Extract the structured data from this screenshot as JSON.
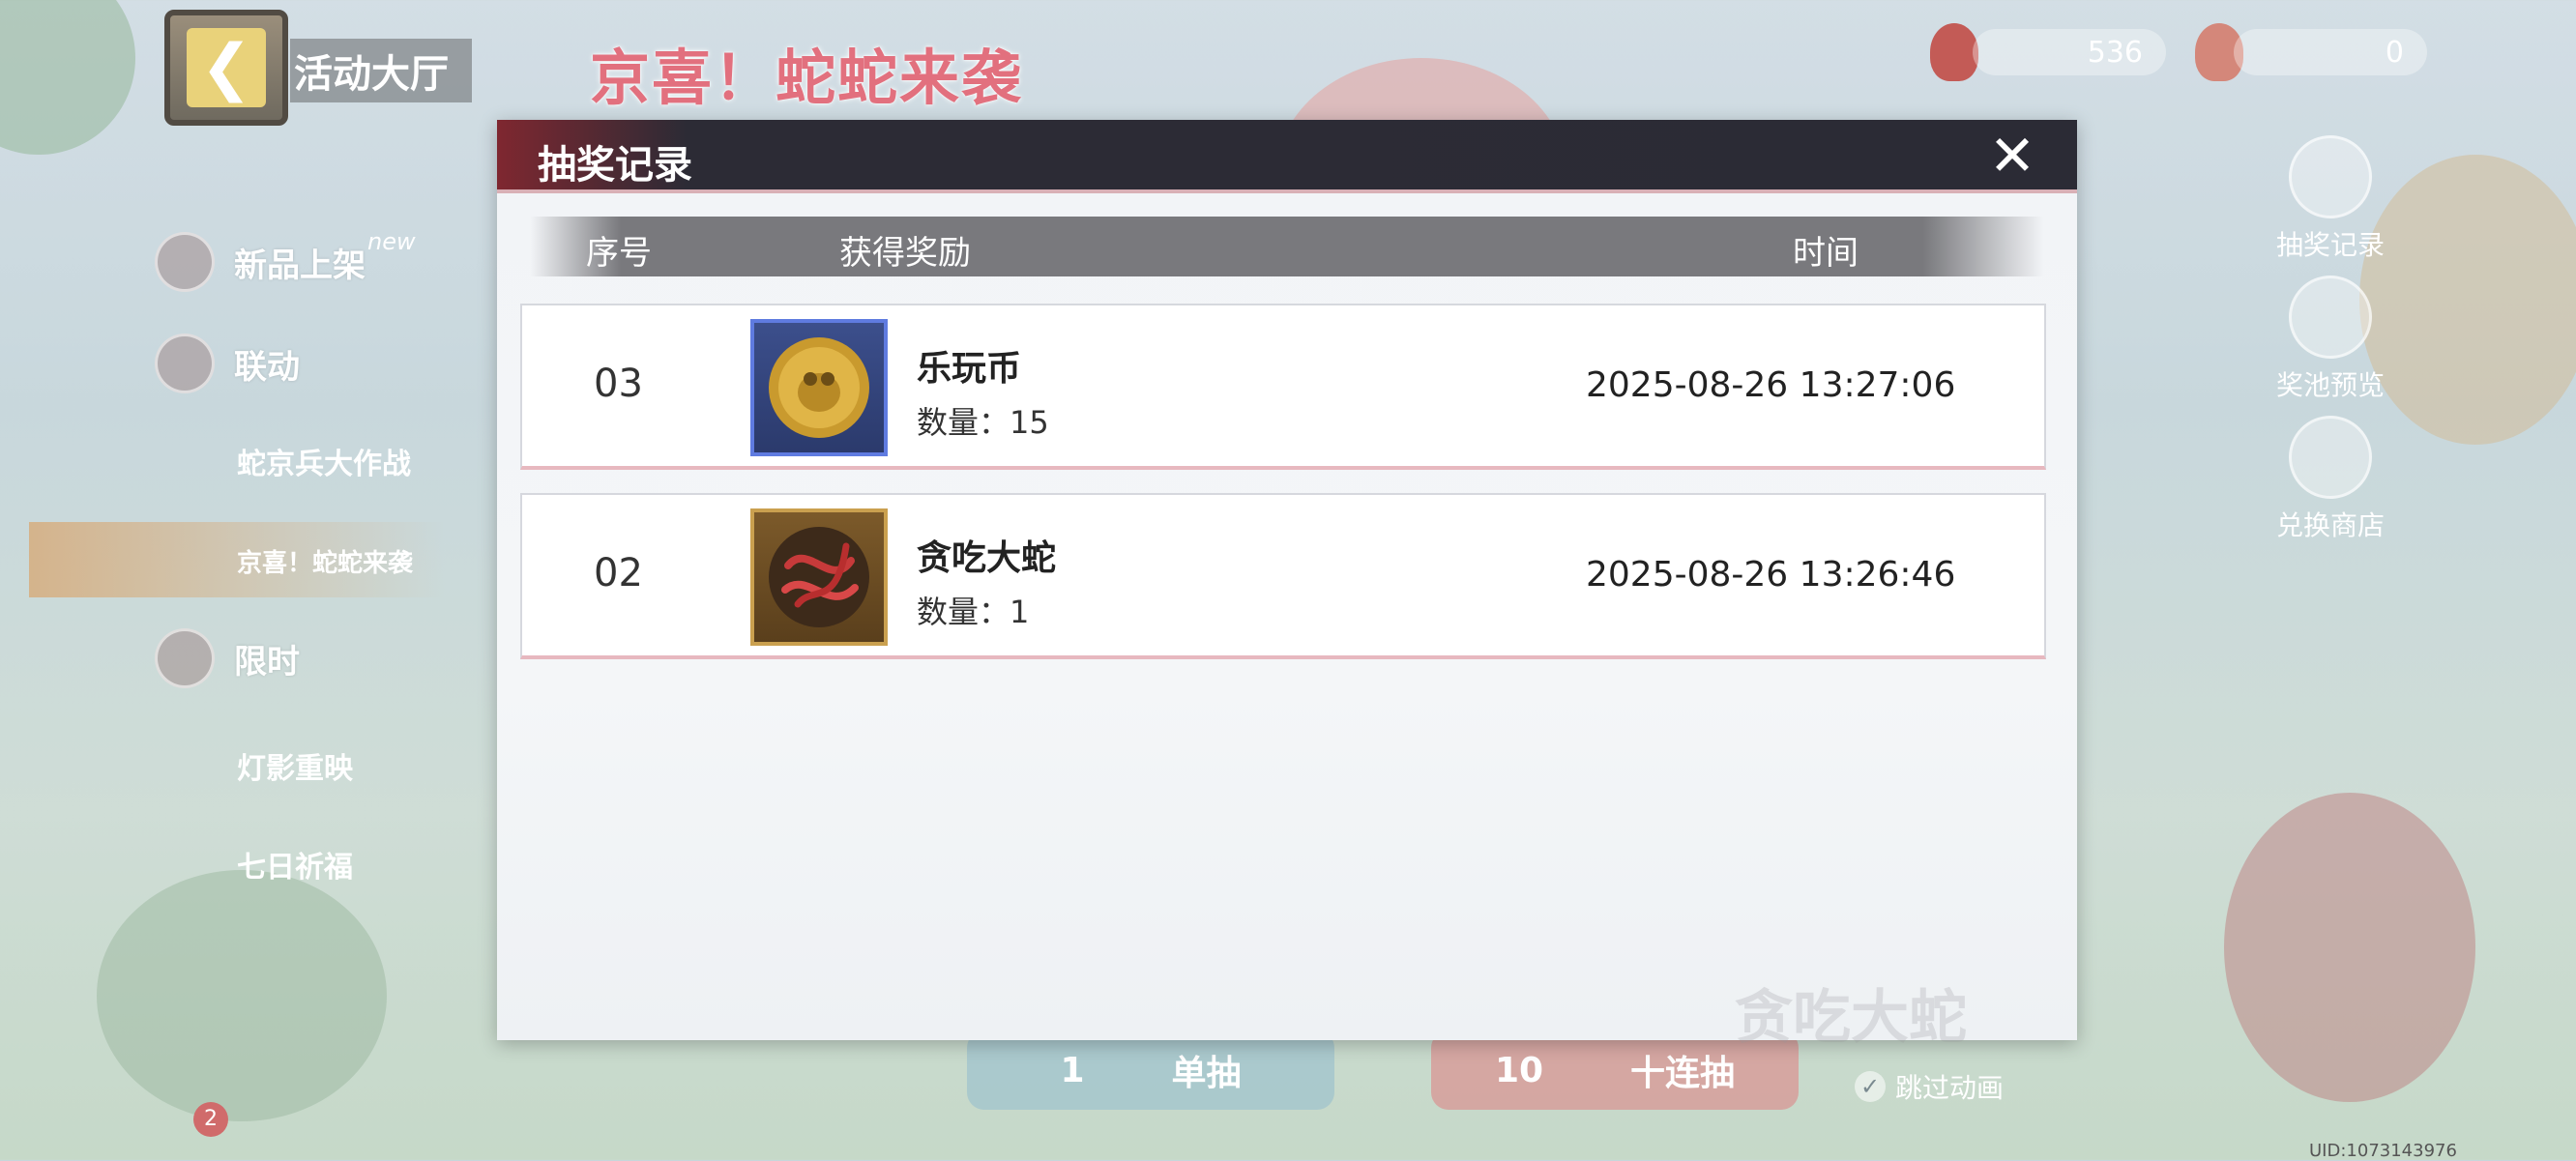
{
  "topbar": {
    "back_label": "活动大厅",
    "banner_title": "京喜！蛇蛇来袭",
    "currency_1": "536",
    "currency_2": "0"
  },
  "sidebar": {
    "new_tag": "new",
    "items": [
      {
        "label": "新品上架"
      },
      {
        "label": "联动"
      },
      {
        "label": "蛇京兵大作战"
      },
      {
        "label": "京喜！蛇蛇来袭"
      },
      {
        "label": "限时"
      },
      {
        "label": "灯影重映"
      },
      {
        "label": "七日祈福"
      }
    ],
    "avatar_badge": "2"
  },
  "right_menu": [
    {
      "label": "抽奖记录"
    },
    {
      "label": "奖池预览"
    },
    {
      "label": "兑换商店"
    }
  ],
  "bottom": {
    "single_count": "1",
    "single_label": "单抽",
    "ten_count": "10",
    "ten_label": "十连抽",
    "skip_label": "跳过动画",
    "uid": "UID:1073143976"
  },
  "modal": {
    "title": "抽奖记录",
    "columns": {
      "seq": "序号",
      "reward": "获得奖励",
      "time": "时间"
    },
    "rows": [
      {
        "seq": "03",
        "name": "乐玩币",
        "qty": "数量：15",
        "time": "2025-08-26 13:27:06",
        "icon": "coin-icon"
      },
      {
        "seq": "02",
        "name": "贪吃大蛇",
        "qty": "数量：1",
        "time": "2025-08-26 13:26:46",
        "icon": "red-snake-icon"
      }
    ],
    "watermark": "贪吃大蛇"
  },
  "colors": {
    "header_dark": "#2b2b35",
    "header_accent": "#7f2730",
    "row_border_accent": "#e7b8bf",
    "banner_pink": "#e2707e"
  }
}
